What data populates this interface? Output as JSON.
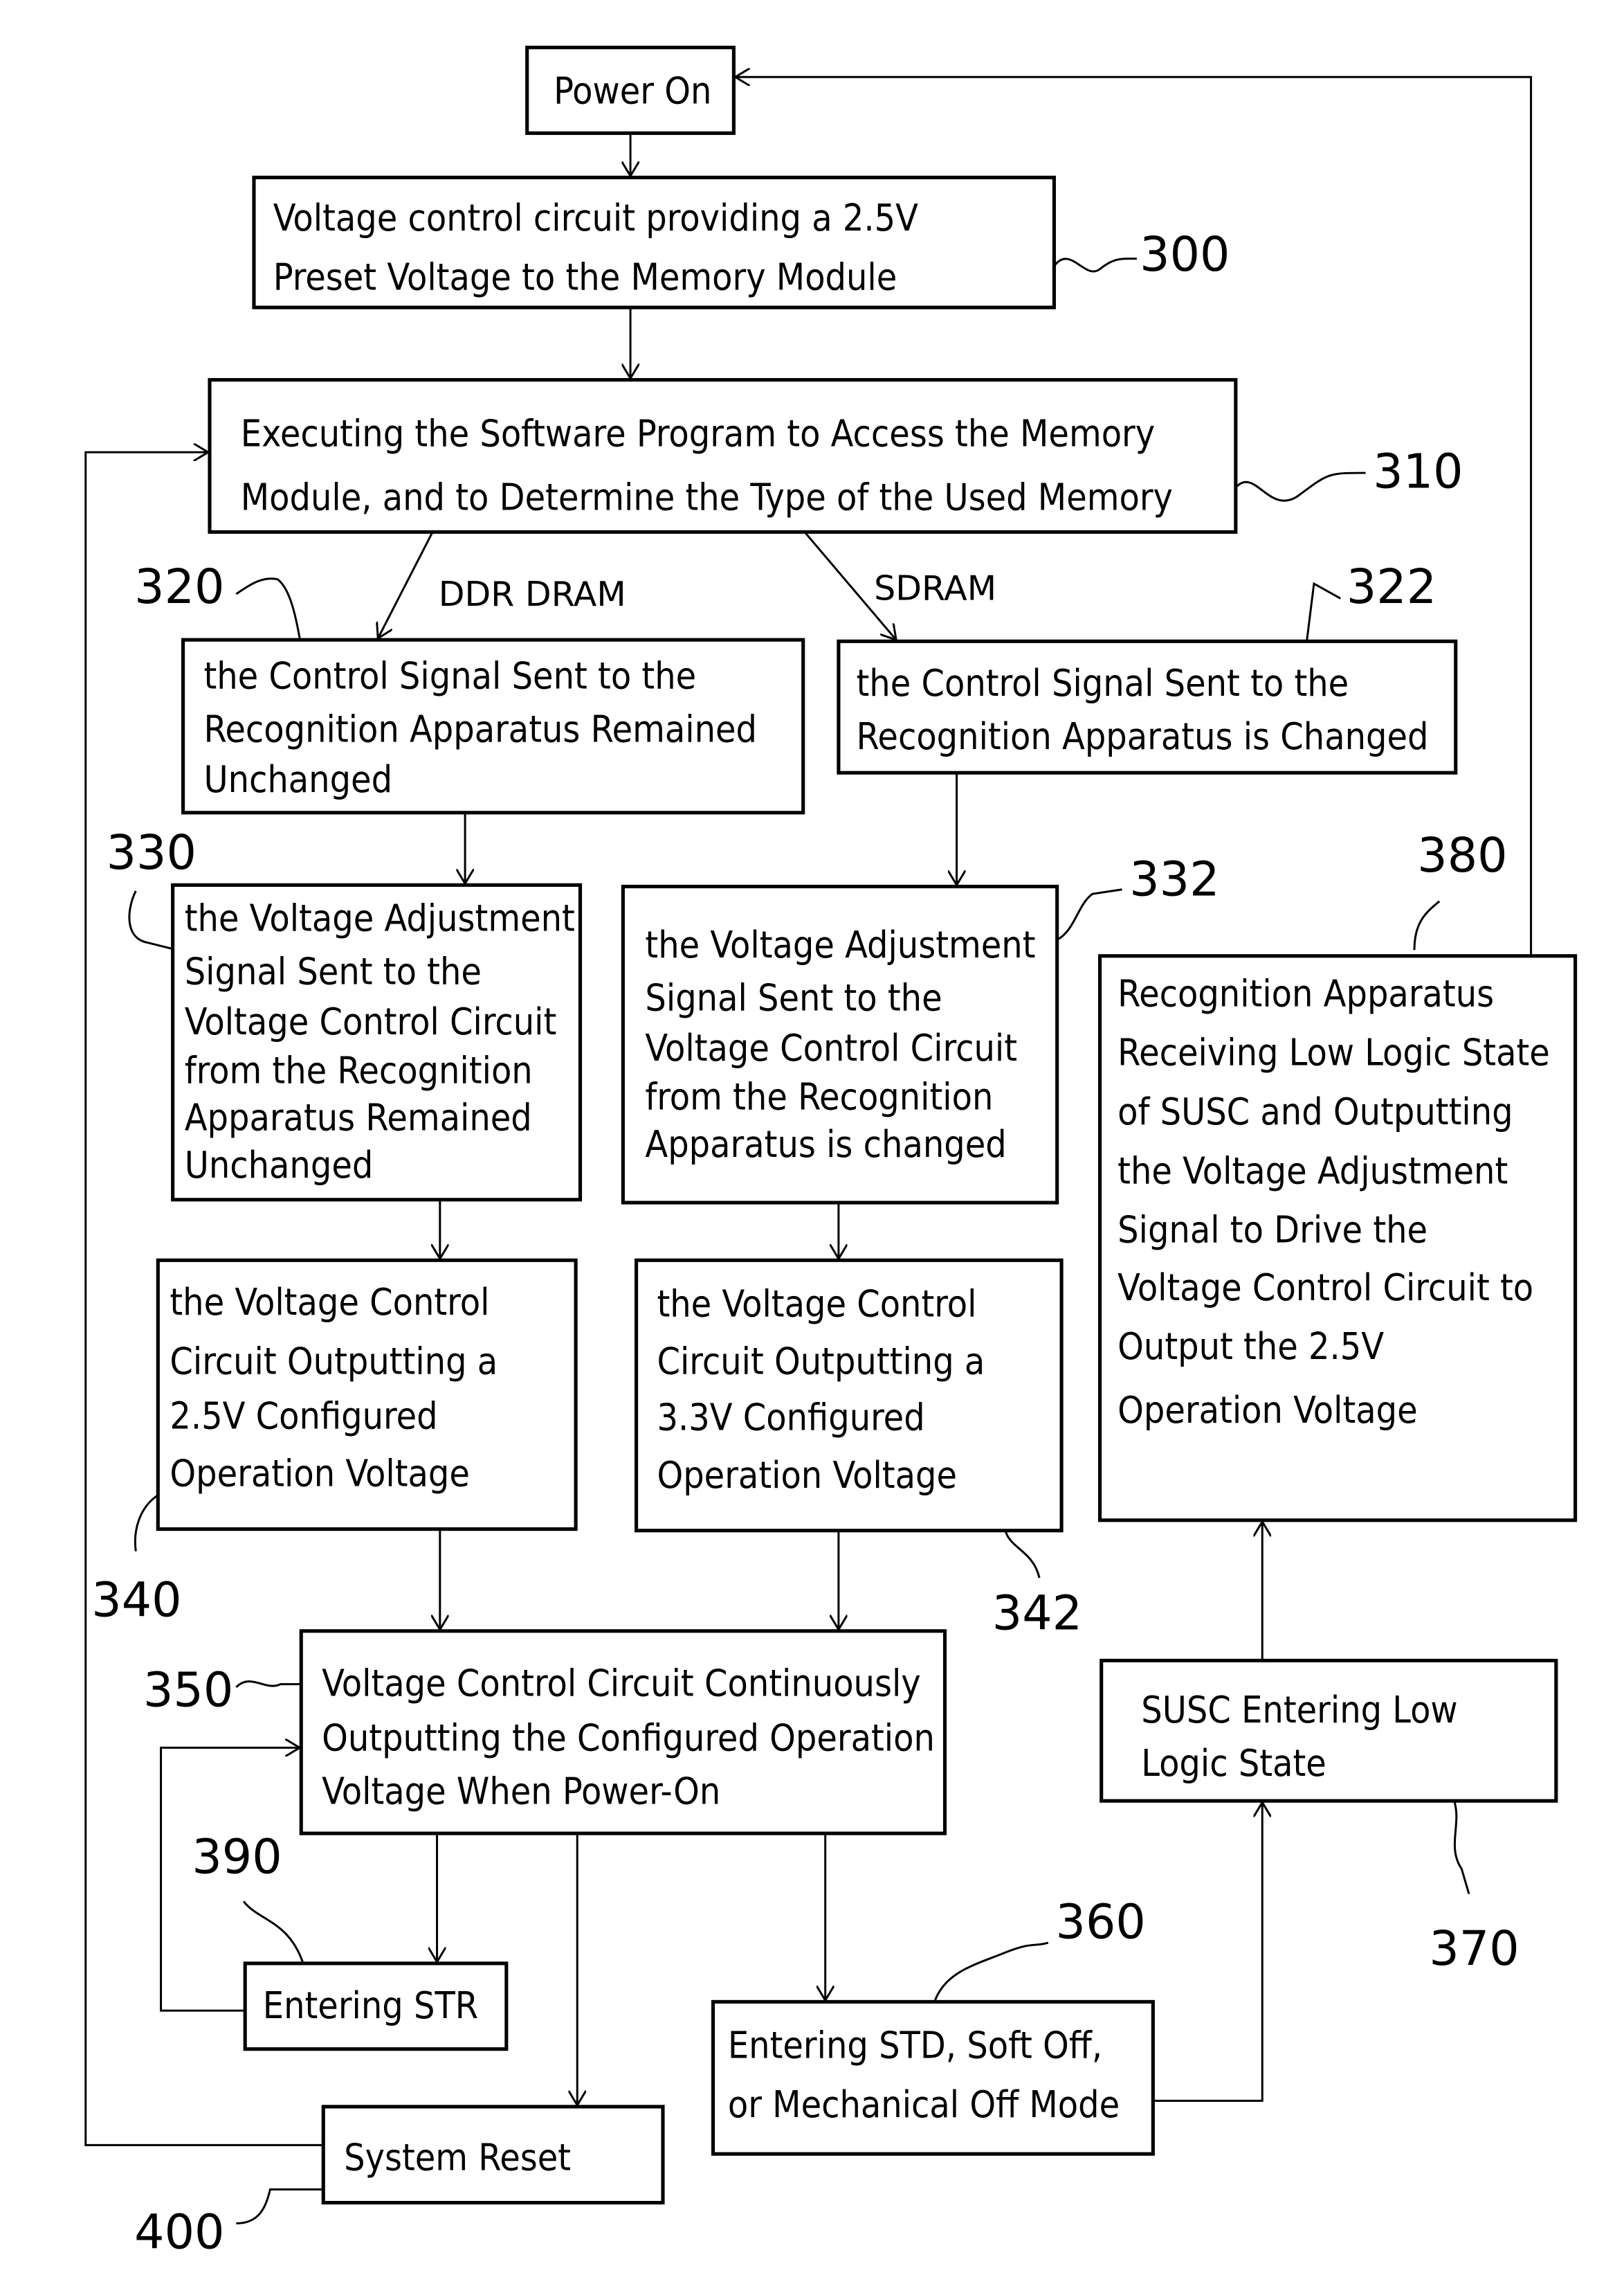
{
  "boxes": {
    "power_on": [
      "Power On"
    ],
    "b300": [
      "Voltage control circuit providing a 2.5V",
      "Preset Voltage to the Memory Module"
    ],
    "b310": [
      "Executing the Software Program to Access the Memory",
      "Module, and to Determine the Type of the Used Memory"
    ],
    "b320": [
      "the Control Signal Sent to the",
      "Recognition Apparatus Remained",
      "Unchanged"
    ],
    "b322": [
      "the Control Signal Sent to the",
      "Recognition Apparatus is Changed"
    ],
    "b330": [
      "the Voltage Adjustment",
      "Signal Sent to the",
      "Voltage Control Circuit",
      "from the Recognition",
      "Apparatus Remained",
      "Unchanged"
    ],
    "b332": [
      "the Voltage Adjustment",
      "Signal Sent to the",
      "Voltage Control Circuit",
      "from the Recognition",
      "Apparatus is changed"
    ],
    "b340": [
      "the Voltage Control",
      "Circuit  Outputting a",
      "2.5V Configured",
      "Operation Voltage"
    ],
    "b342": [
      "the Voltage Control",
      "Circuit  Outputting a",
      "3.3V Configured",
      "Operation Voltage"
    ],
    "b350": [
      "Voltage Control Circuit Continuously",
      "Outputting the Configured Operation",
      "Voltage When Power-On"
    ],
    "b360": [
      "Entering STD, Soft Off,",
      "or Mechanical Off Mode"
    ],
    "b370": [
      "SUSC Entering Low",
      "Logic State"
    ],
    "b380": [
      "Recognition Apparatus",
      "Receiving Low Logic State",
      "of SUSC and Outputting",
      "the Voltage Adjustment",
      "Signal to Drive the",
      "Voltage Control Circuit to",
      "Output the 2.5V",
      "Operation Voltage"
    ],
    "b390": [
      "Entering STR"
    ],
    "b400": [
      "System Reset"
    ]
  },
  "refs": {
    "r300": "300",
    "r310": "310",
    "r320": "320",
    "r322": "322",
    "r330": "330",
    "r332": "332",
    "r340": "340",
    "r342": "342",
    "r350": "350",
    "r360": "360",
    "r370": "370",
    "r380": "380",
    "r390": "390",
    "r400": "400"
  },
  "branch_labels": {
    "ddr": "DDR DRAM",
    "sdram": "SDRAM"
  }
}
